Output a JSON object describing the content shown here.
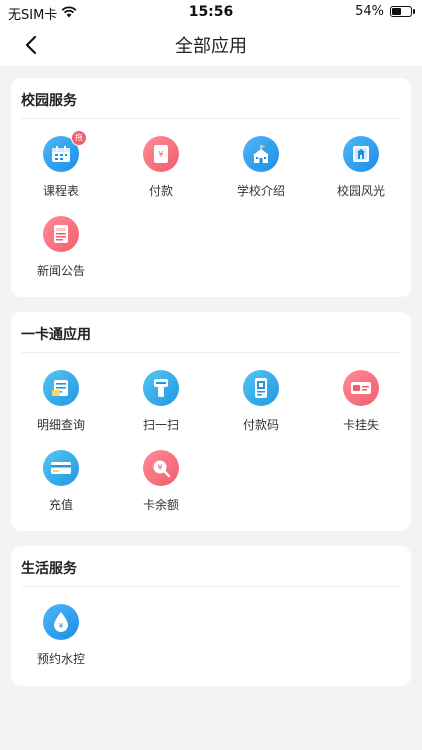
{
  "status_bar": {
    "carrier": "无SIM卡",
    "time": "15:56",
    "battery_text": "54%",
    "battery_level": 0.54
  },
  "nav": {
    "title": "全部应用"
  },
  "colors": {
    "accent_blue": "#1b8ee8",
    "accent_red": "#f25d6b",
    "page_bg": "#f2f3f5"
  },
  "sections": [
    {
      "title": "校园服务",
      "items": [
        {
          "label": "课程表",
          "icon": "calendar-icon",
          "badge": "拖"
        },
        {
          "label": "付款",
          "icon": "yen-payment-icon"
        },
        {
          "label": "学校介绍",
          "icon": "school-building-icon"
        },
        {
          "label": "校园风光",
          "icon": "landscape-icon"
        },
        {
          "label": "新闻公告",
          "icon": "news-icon"
        }
      ]
    },
    {
      "title": "一卡通应用",
      "items": [
        {
          "label": "明细查询",
          "icon": "detail-list-icon"
        },
        {
          "label": "扫一扫",
          "icon": "scanner-icon"
        },
        {
          "label": "付款码",
          "icon": "payment-code-icon"
        },
        {
          "label": "卡挂失",
          "icon": "card-lost-icon"
        },
        {
          "label": "充值",
          "icon": "recharge-card-icon"
        },
        {
          "label": "卡余额",
          "icon": "balance-search-icon"
        }
      ]
    },
    {
      "title": "生活服务",
      "items": [
        {
          "label": "预约水控",
          "icon": "water-drop-icon"
        }
      ]
    }
  ]
}
